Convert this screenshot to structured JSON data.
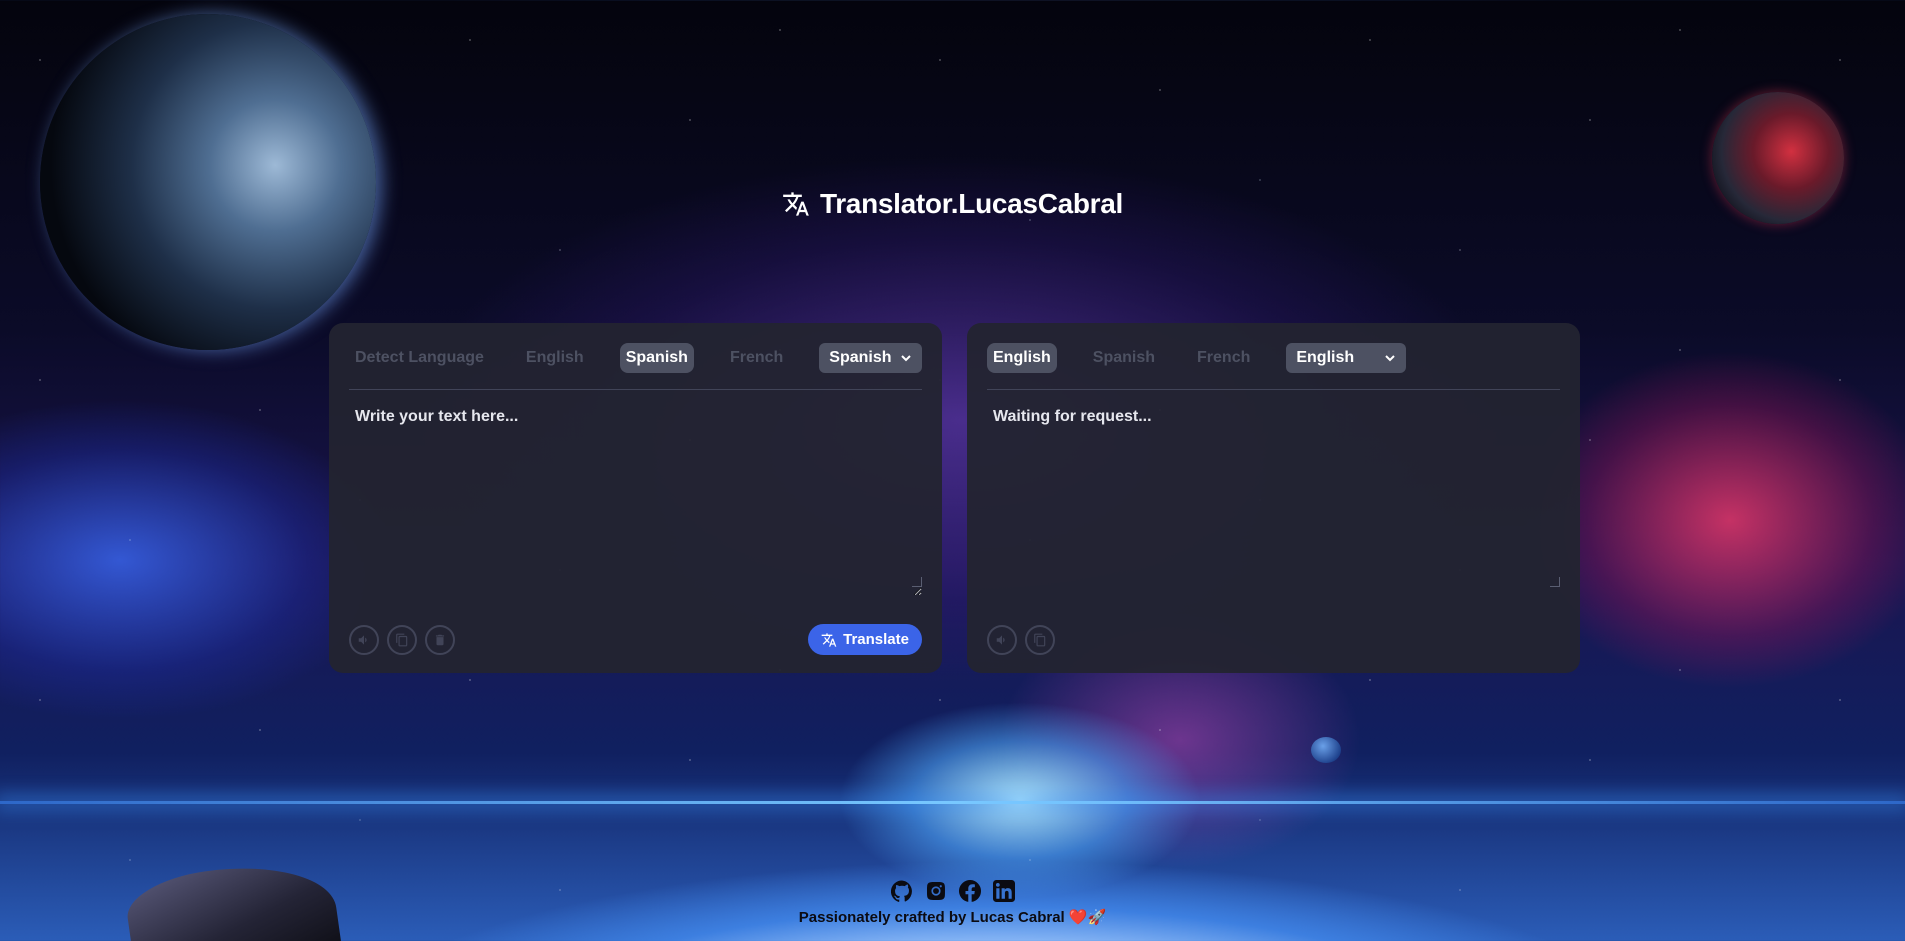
{
  "app": {
    "title": "Translator.LucasCabral"
  },
  "source_panel": {
    "languages": [
      "Detect Language",
      "English",
      "Spanish",
      "French"
    ],
    "active_language": "Spanish",
    "select_value": "Spanish",
    "placeholder": "Write your text here...",
    "translate_label": "Translate",
    "icons": [
      "speaker-icon",
      "copy-icon",
      "trash-icon"
    ]
  },
  "target_panel": {
    "languages": [
      "English",
      "Spanish",
      "French"
    ],
    "active_language": "English",
    "select_value": "English",
    "output_text": "Waiting for request...",
    "icons": [
      "speaker-icon",
      "copy-icon"
    ]
  },
  "footer": {
    "credit": "Passionately crafted by Lucas Cabral ❤️🚀",
    "social": [
      "github-icon",
      "instagram-icon",
      "facebook-icon",
      "linkedin-icon"
    ]
  },
  "colors": {
    "panel_bg": "#232430",
    "accent": "#3b64e8",
    "muted": "#4d5162"
  }
}
